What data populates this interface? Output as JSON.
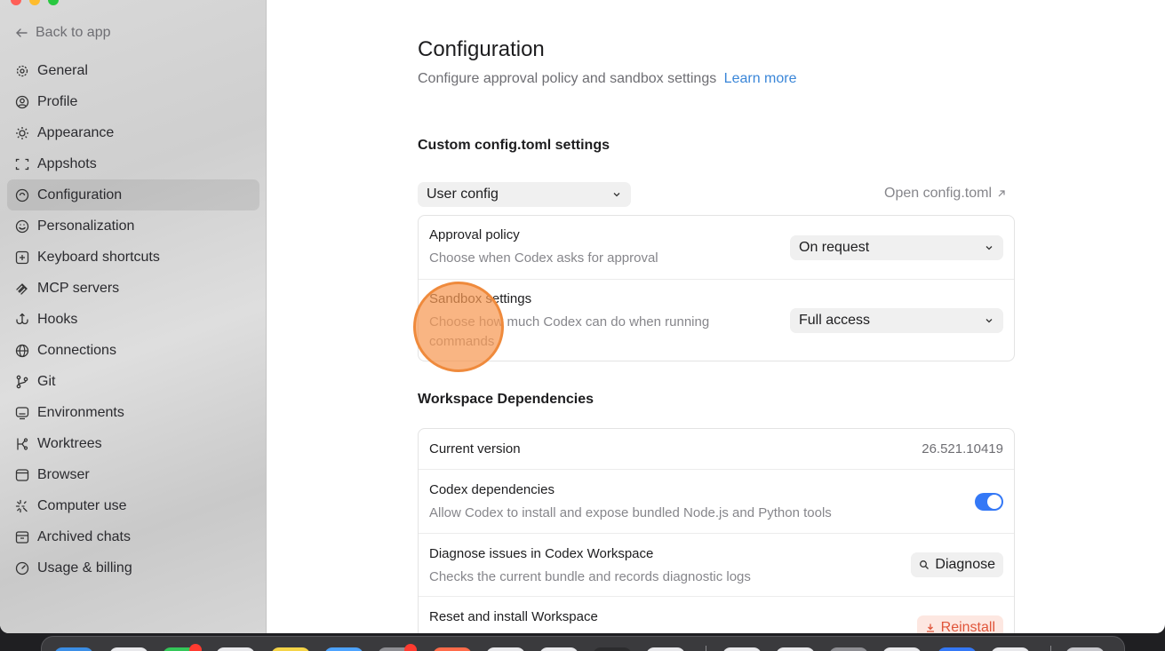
{
  "sidebar": {
    "back_label": "Back to app",
    "items": [
      {
        "label": "General",
        "icon": "gear-icon"
      },
      {
        "label": "Profile",
        "icon": "user-circle-icon"
      },
      {
        "label": "Appearance",
        "icon": "sun-icon"
      },
      {
        "label": "Appshots",
        "icon": "screenshot-frame-icon"
      },
      {
        "label": "Configuration",
        "icon": "config-icon",
        "active": true
      },
      {
        "label": "Personalization",
        "icon": "personalization-icon"
      },
      {
        "label": "Keyboard shortcuts",
        "icon": "keyboard-icon"
      },
      {
        "label": "MCP servers",
        "icon": "mcp-icon"
      },
      {
        "label": "Hooks",
        "icon": "hook-icon"
      },
      {
        "label": "Connections",
        "icon": "globe-icon"
      },
      {
        "label": "Git",
        "icon": "git-branch-icon"
      },
      {
        "label": "Environments",
        "icon": "monitor-icon"
      },
      {
        "label": "Worktrees",
        "icon": "worktree-icon"
      },
      {
        "label": "Browser",
        "icon": "browser-icon"
      },
      {
        "label": "Computer use",
        "icon": "sparkle-icon"
      },
      {
        "label": "Archived chats",
        "icon": "archive-icon"
      },
      {
        "label": "Usage & billing",
        "icon": "gauge-icon"
      }
    ]
  },
  "main": {
    "title": "Configuration",
    "subtitle": "Configure approval policy and sandbox settings",
    "learn_more": "Learn more",
    "custom_section": {
      "heading": "Custom config.toml settings",
      "scope_select": "User config",
      "open_link": "Open config.toml",
      "rows": [
        {
          "title": "Approval policy",
          "description": "Choose when Codex asks for approval",
          "value": "On request"
        },
        {
          "title": "Sandbox settings",
          "description": "Choose how much Codex can do when running commands",
          "value": "Full access"
        }
      ]
    },
    "workspace_section": {
      "heading": "Workspace Dependencies",
      "current_version_label": "Current version",
      "current_version_value": "26.521.10419",
      "codex_deps_title": "Codex dependencies",
      "codex_deps_desc": "Allow Codex to install and expose bundled Node.js and Python tools",
      "codex_deps_enabled": true,
      "diagnose_title": "Diagnose issues in Codex Workspace",
      "diagnose_desc": "Checks the current bundle and records diagnostic logs",
      "diagnose_button": "Diagnose",
      "reset_title": "Reset and install Workspace",
      "reinstall_button": "Reinstall"
    }
  },
  "colors": {
    "accent_link": "#3a86d8",
    "toggle_on": "#3478f6",
    "danger": "#e0553a",
    "cursor_highlight": "#f69953"
  }
}
